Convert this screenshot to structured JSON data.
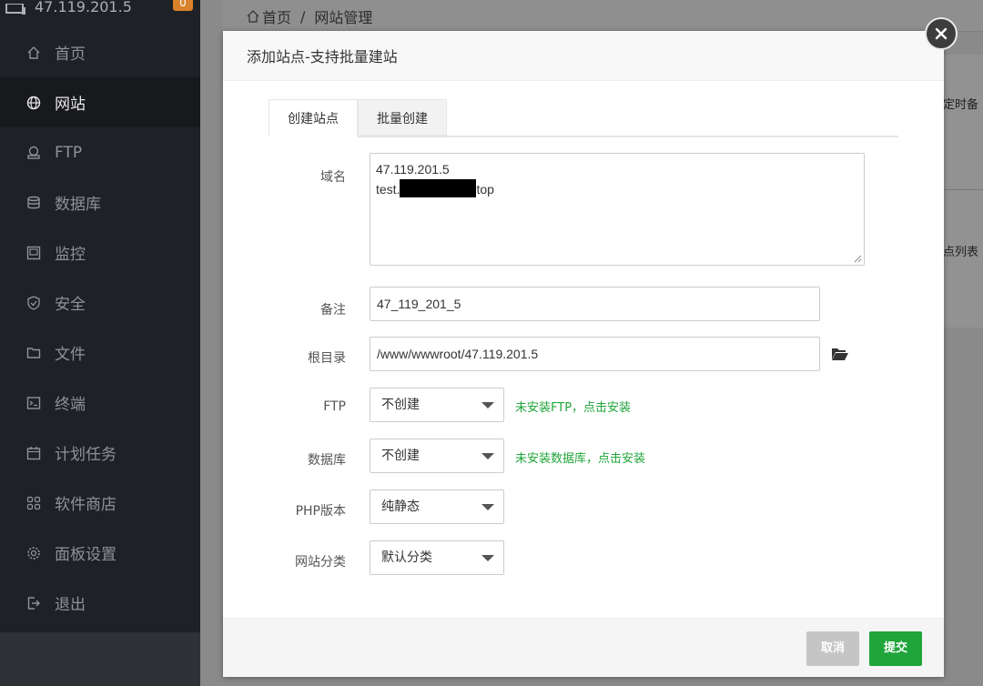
{
  "app": {
    "server_ip": "47.119.201.5",
    "notice_count": "0"
  },
  "sidebar": {
    "items": [
      {
        "label": "首页",
        "icon": "home-icon"
      },
      {
        "label": "网站",
        "icon": "globe-icon"
      },
      {
        "label": "FTP",
        "icon": "ftp-icon"
      },
      {
        "label": "数据库",
        "icon": "database-icon"
      },
      {
        "label": "监控",
        "icon": "monitor-icon"
      },
      {
        "label": "安全",
        "icon": "shield-icon"
      },
      {
        "label": "文件",
        "icon": "folder-icon"
      },
      {
        "label": "终端",
        "icon": "terminal-icon"
      },
      {
        "label": "计划任务",
        "icon": "calendar-icon"
      },
      {
        "label": "软件商店",
        "icon": "apps-icon"
      },
      {
        "label": "面板设置",
        "icon": "gear-icon"
      },
      {
        "label": "退出",
        "icon": "logout-icon"
      }
    ],
    "active_index": 1
  },
  "breadcrumb": {
    "home": "首页",
    "separator": "/",
    "current": "网站管理"
  },
  "background": {
    "text_1": "定时备",
    "text_2": "点列表"
  },
  "modal": {
    "title": "添加站点-支持批量建站",
    "tabs": [
      {
        "label": "创建站点",
        "active": true
      },
      {
        "label": "批量创建",
        "active": false
      }
    ],
    "form": {
      "domain_label": "域名",
      "domain_line_1": "47.119.201.5",
      "domain_line_2_prefix": "test.",
      "domain_line_2_suffix": "top",
      "note_label": "备注",
      "note_value": "47_119_201_5",
      "root_label": "根目录",
      "root_value": "/www/wwwroot/47.119.201.5",
      "ftp_label": "FTP",
      "ftp_value": "不创建",
      "ftp_hint": "未安装FTP，点击安装",
      "db_label": "数据库",
      "db_value": "不创建",
      "db_hint": "未安装数据库，点击安装",
      "php_label": "PHP版本",
      "php_value": "纯静态",
      "category_label": "网站分类",
      "category_value": "默认分类"
    },
    "buttons": {
      "cancel": "取消",
      "submit": "提交"
    }
  },
  "colors": {
    "accent_green": "#20a53a",
    "sidebar_bg": "#1e2125",
    "overlay_bg": "#8a8a8a"
  }
}
